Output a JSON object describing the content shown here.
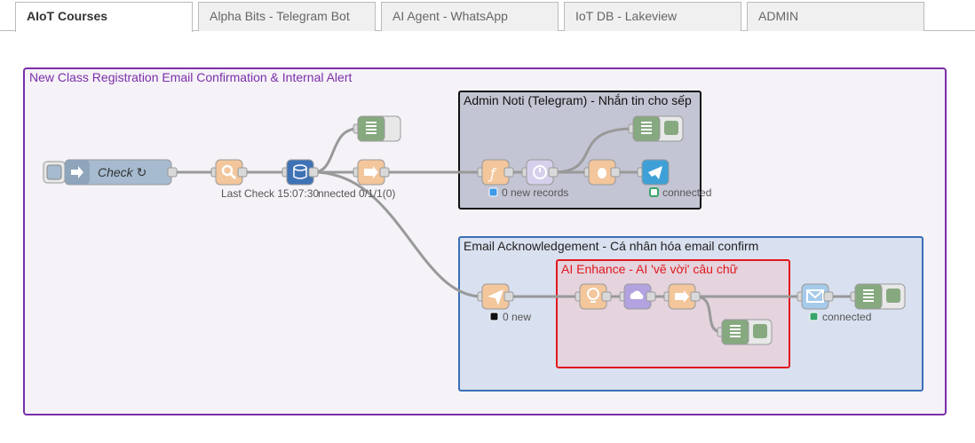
{
  "tabs": [
    {
      "label": "AIoT Courses",
      "active": true
    },
    {
      "label": "Alpha Bits - Telegram Bot"
    },
    {
      "label": "AI Agent - WhatsApp"
    },
    {
      "label": "IoT DB - Lakeview"
    },
    {
      "label": "ADMIN"
    }
  ],
  "groups": {
    "outer": {
      "title": "New Class Registration Email Confirmation & Internal Alert",
      "color": "#7b2fa8"
    },
    "admin": {
      "title": "Admin Noti (Telegram) - Nhắn tin cho sếp",
      "color": "#111111"
    },
    "email": {
      "title": "Email Acknowledgement - Cá nhân hóa email confirm",
      "color": "#3a6fb7"
    },
    "ai": {
      "title": "AI Enhance - AI 'vẽ vời' câu chữ",
      "color": "#e0191d"
    }
  },
  "nodes": {
    "check": {
      "label": "Check ↻"
    },
    "last_check_status": "Last Check 15:07:30",
    "connected_status": "nnected 0/1/1(0)",
    "new_records_status": "0 new records",
    "telegram_status": "connected",
    "new_status": "0 new",
    "email_status": "connected"
  },
  "colors": {
    "orange_node": "#f3c69b",
    "green_node": "#87a980",
    "blue_node": "#3f72b5",
    "telegram_node": "#3ea0d6",
    "email_node": "#a6cbea",
    "purple_node": "#b2a2e0",
    "lavender_node": "#d6d0ec",
    "inject_node": "#a6bbcf"
  }
}
